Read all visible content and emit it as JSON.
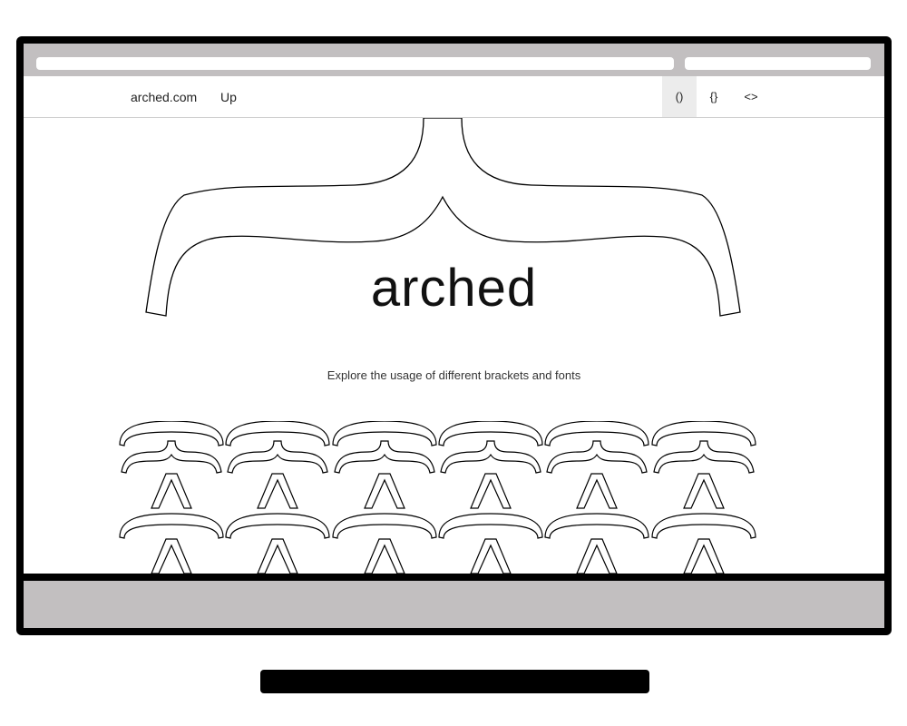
{
  "nav": {
    "brand": "arched.com",
    "up": "Up",
    "tabs": [
      "()",
      "{}",
      "<>"
    ],
    "active_tab": 0
  },
  "hero": {
    "title": "arched",
    "subtitle": "Explore the usage of different brackets and fonts"
  },
  "icons": {
    "hero": "curly-brace-icon",
    "pattern": "arch-glyph-icon"
  }
}
